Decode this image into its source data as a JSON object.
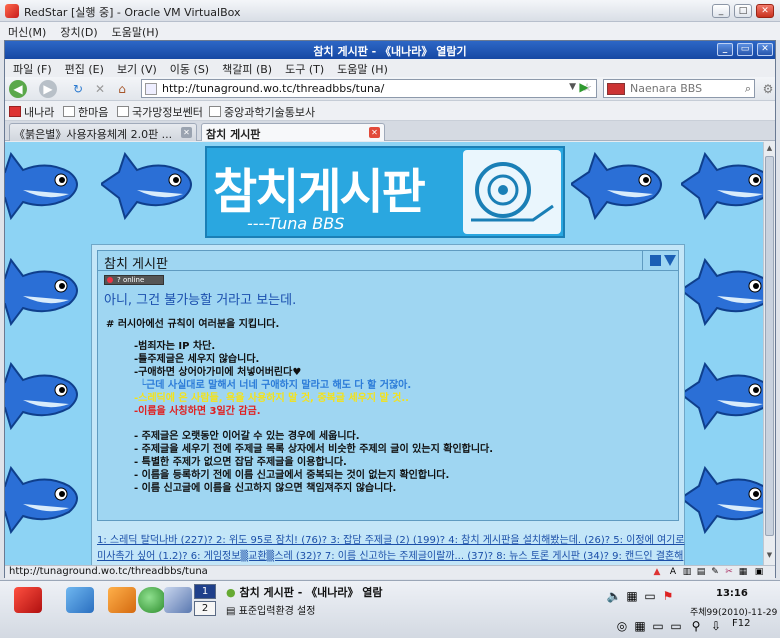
{
  "host_window": {
    "title": "RedStar [실행 중] - Oracle VM VirtualBox",
    "menu": [
      "머신(M)",
      "장치(D)",
      "도움말(H)"
    ]
  },
  "browser": {
    "title": "참치 게시판 - 《내나라》 열람기",
    "menu": [
      "파일 (F)",
      "편집 (E)",
      "보기 (V)",
      "이동 (S)",
      "책갈피 (B)",
      "도구 (T)",
      "도움말 (H)"
    ],
    "url": "http://tunaground.wo.tc/threadbbs/tuna/",
    "search_placeholder": "Naenara BBS",
    "bookmarks": [
      "내나라",
      "한마음",
      "국가망정보쎈터",
      "중앙과학기술통보사"
    ],
    "tabs": [
      {
        "label": "《붉은별》사용자용체계 2.0판 ..."
      },
      {
        "label": "참치 게시판"
      }
    ],
    "status_text": "http://tunaground.wo.tc/threadbbs/tuna"
  },
  "page": {
    "banner_title": "참치게시판",
    "banner_sub": "----Tuna BBS",
    "board_title": "참치 게시판",
    "online_label": "? online",
    "thread_title": "아니, 그건 불가능할 거라고 보는데.",
    "rules_heading": "# 러시아에선 규칙이 여러분을 지킵니다.",
    "rules_a": [
      "-범죄자는 IP 차단.",
      "-틀주제글은 세우지 않습니다.",
      "-구애하면 상어아가미에 처넣어버린다♥"
    ],
    "rules_a4": "└근데 사실대로 말해서 너네 구애하지 말라고 해도 다 할 거잖아.",
    "rules_a5": "-스레딕에 온 사람들, 욕을 사용하지 말 것, 중복글 세우지 말 것..",
    "rules_a6": "-이름을 사칭하면 3일간 감금.",
    "rules_b": [
      "- 주제글은 오랫동안 이어갈 수 있는 경우에 세웁니다.",
      "- 주제글을 세우기 전에 주제글 목록 상자에서 비슷한 주제의 글이 있는지 확인합니다.",
      "- 특별한 주제가 없으면 잡담 주제글을 이용합니다.",
      "- 이름을 등록하기 전에 이름 신고글에서 중복되는 것이 없는지 확인합니다.",
      "- 이름 신고글에 이름을 신고하지 않으면 책임져주지 않습니다."
    ],
    "thread_links_1": "1: 스레딕 탈덕나바 (227)? 2: 위도 95로 잠치! (76)? 3: 잡담 주제글 (2) (199)? 4: 참치 게시판을 설치해봤는데. (26)? 5: 이정에 여기로",
    "thread_links_2": "미사촉가 싶어 (1.2)? 6: 게임정보▒교환▒스레 (32)? 7: 이름 신고하는 주제글이랄까... (37)? 8: 뉴스 토론 게시판 (34)? 9: 캔드인 결혼해"
  },
  "taskbar": {
    "workspaces": [
      "1",
      "2"
    ],
    "task_label": "참치 게시판 - 《내나라》 열람",
    "ime_label": "표준입력환경 설정",
    "clock": "13:16",
    "date": "주체99(2010)-11-29",
    "kbd": "F12"
  }
}
